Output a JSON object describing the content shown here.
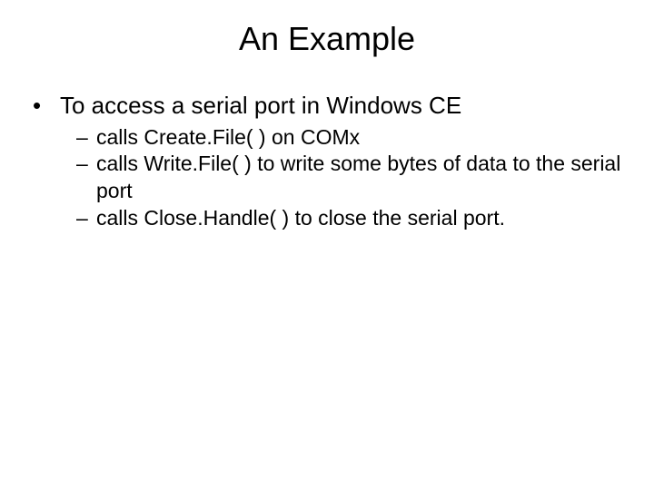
{
  "title": "An Example",
  "bullet": {
    "text": "To access a serial port in Windows CE",
    "sub": [
      "calls Create.File( ) on COMx",
      " calls Write.File( ) to write some bytes of data to the serial port",
      "calls Close.Handle( ) to close the serial port."
    ]
  }
}
